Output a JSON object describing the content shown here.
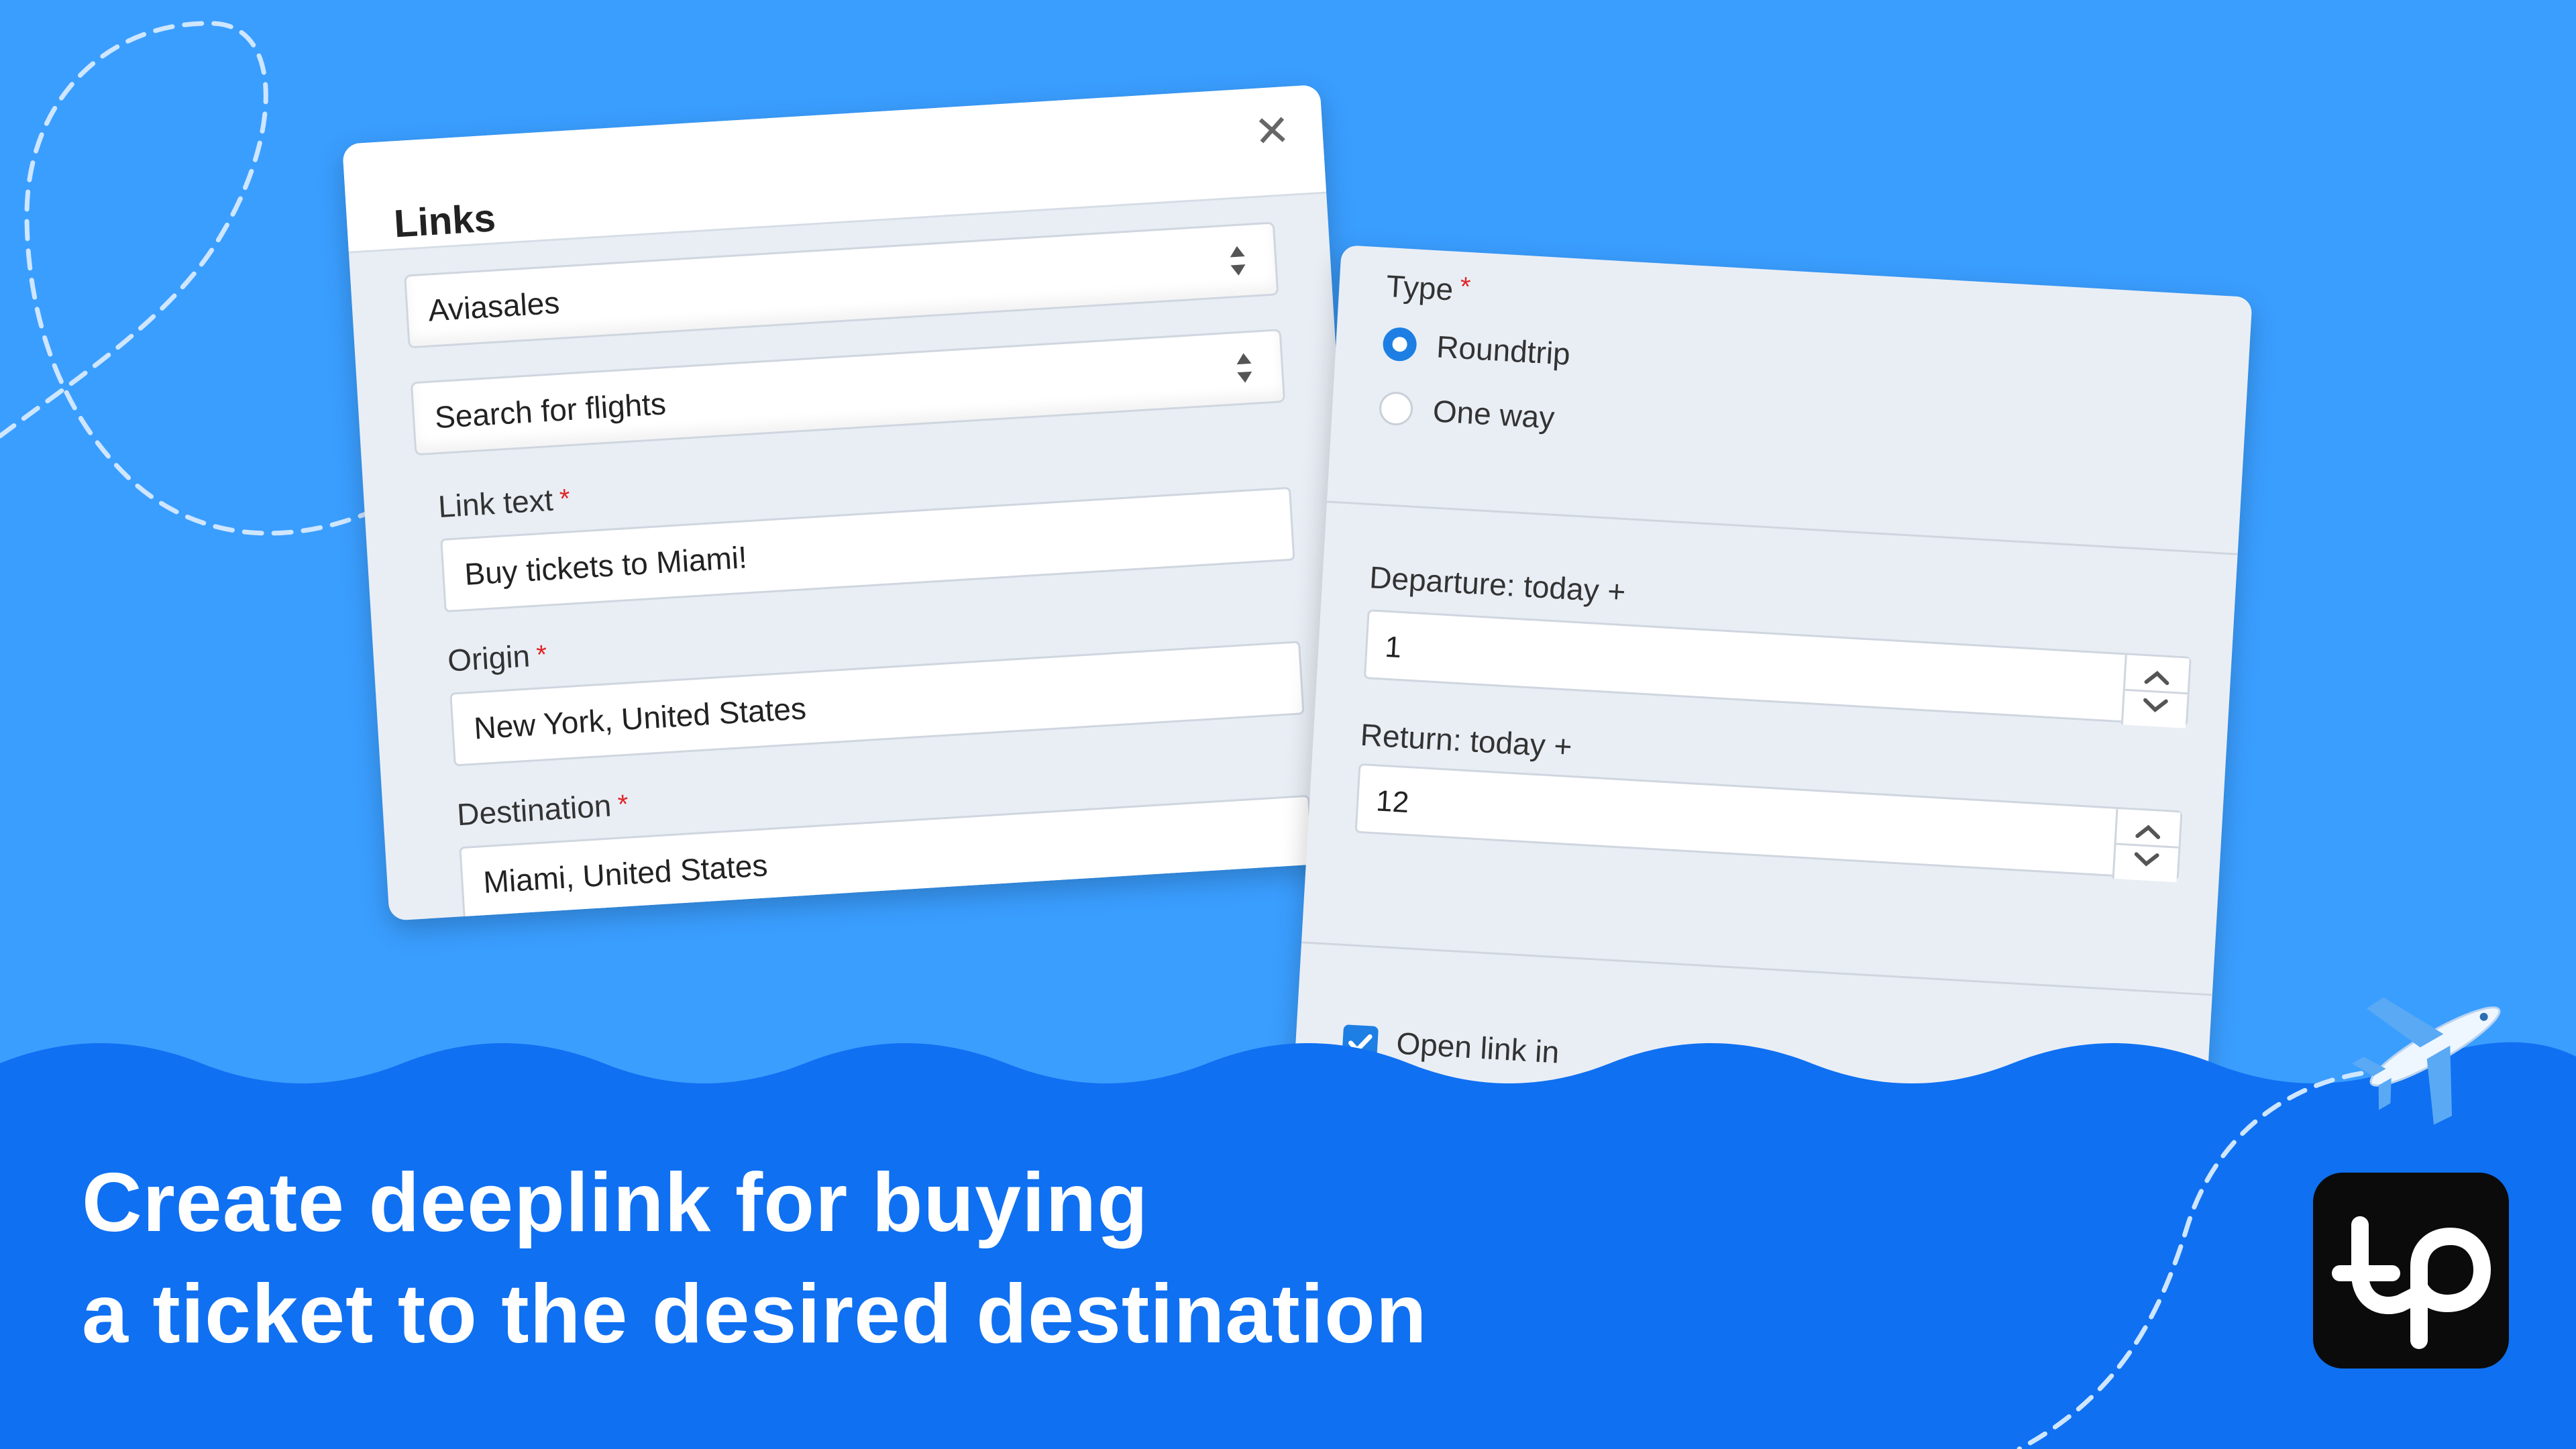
{
  "links_dialog": {
    "title": "Links",
    "close_icon": "close-icon",
    "provider_select": "Aviasales",
    "search_type_select": "Search for flights",
    "link_text": {
      "label": "Link text",
      "required_mark": "*",
      "value": "Buy tickets to Miami!"
    },
    "origin": {
      "label": "Origin",
      "required_mark": "*",
      "value": "New York, United States"
    },
    "destination": {
      "label": "Destination",
      "required_mark": "*",
      "value": "Miami, United States"
    }
  },
  "type_panel": {
    "type_label": "Type",
    "required_mark": "*",
    "options": [
      {
        "label": "Roundtrip",
        "selected": true
      },
      {
        "label": "One way",
        "selected": false
      }
    ],
    "departure": {
      "label": "Departure: today +",
      "value": "1"
    },
    "return": {
      "label": "Return: today +",
      "value": "12"
    },
    "open_link": {
      "label": "Open link in",
      "checked": true
    }
  },
  "headline": {
    "line1": "Create deeplink for buying",
    "line2": "a ticket to the desired destination"
  },
  "logo": {
    "icon": "travelpayouts-logo-icon"
  },
  "decor": {
    "plane_icon": "airplane-icon"
  },
  "colors": {
    "background": "#3a9eff",
    "wave": "#0f70f2",
    "accent": "#1d7fe3",
    "required": "#e02424",
    "logo_bg": "#0b0b0b"
  }
}
